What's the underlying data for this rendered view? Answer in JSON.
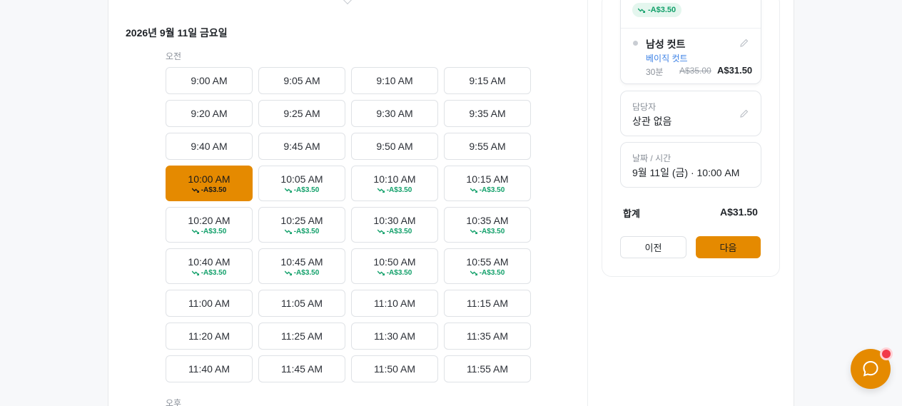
{
  "booking": {
    "date_heading": "2026년 9월 11일 금요일",
    "morning_label": "오전",
    "afternoon_label": "오후",
    "slots": [
      {
        "time": "9:00 AM",
        "discount": ""
      },
      {
        "time": "9:05 AM",
        "discount": ""
      },
      {
        "time": "9:10 AM",
        "discount": ""
      },
      {
        "time": "9:15 AM",
        "discount": ""
      },
      {
        "time": "9:20 AM",
        "discount": ""
      },
      {
        "time": "9:25 AM",
        "discount": ""
      },
      {
        "time": "9:30 AM",
        "discount": ""
      },
      {
        "time": "9:35 AM",
        "discount": ""
      },
      {
        "time": "9:40 AM",
        "discount": ""
      },
      {
        "time": "9:45 AM",
        "discount": ""
      },
      {
        "time": "9:50 AM",
        "discount": ""
      },
      {
        "time": "9:55 AM",
        "discount": ""
      },
      {
        "time": "10:00 AM",
        "discount": "-A$3.50",
        "selected": true
      },
      {
        "time": "10:05 AM",
        "discount": "-A$3.50"
      },
      {
        "time": "10:10 AM",
        "discount": "-A$3.50"
      },
      {
        "time": "10:15 AM",
        "discount": "-A$3.50"
      },
      {
        "time": "10:20 AM",
        "discount": "-A$3.50"
      },
      {
        "time": "10:25 AM",
        "discount": "-A$3.50"
      },
      {
        "time": "10:30 AM",
        "discount": "-A$3.50"
      },
      {
        "time": "10:35 AM",
        "discount": "-A$3.50"
      },
      {
        "time": "10:40 AM",
        "discount": "-A$3.50"
      },
      {
        "time": "10:45 AM",
        "discount": "-A$3.50"
      },
      {
        "time": "10:50 AM",
        "discount": "-A$3.50"
      },
      {
        "time": "10:55 AM",
        "discount": "-A$3.50"
      },
      {
        "time": "11:00 AM",
        "discount": ""
      },
      {
        "time": "11:05 AM",
        "discount": ""
      },
      {
        "time": "11:10 AM",
        "discount": ""
      },
      {
        "time": "11:15 AM",
        "discount": ""
      },
      {
        "time": "11:20 AM",
        "discount": ""
      },
      {
        "time": "11:25 AM",
        "discount": ""
      },
      {
        "time": "11:30 AM",
        "discount": ""
      },
      {
        "time": "11:35 AM",
        "discount": ""
      },
      {
        "time": "11:40 AM",
        "discount": ""
      },
      {
        "time": "11:45 AM",
        "discount": ""
      },
      {
        "time": "11:50 AM",
        "discount": ""
      },
      {
        "time": "11:55 AM",
        "discount": ""
      }
    ]
  },
  "summary": {
    "discount_pill": "-A$3.50",
    "service_name": "남성 컷트",
    "service_option": "베이직 컷트",
    "duration": "30분",
    "original_price": "A$35.00",
    "price": "A$31.50",
    "staff_label": "담당자",
    "staff_value": "상관 없음",
    "datetime_label": "날짜 / 시간",
    "datetime_value": "9월 11일 (금) · 10:00 AM",
    "total_label": "합계",
    "total_value": "A$31.50",
    "prev_label": "이전",
    "next_label": "다음"
  },
  "colors": {
    "accent": "#e58a00",
    "discount_green": "#12a06a",
    "link_blue": "#3d82e6"
  }
}
